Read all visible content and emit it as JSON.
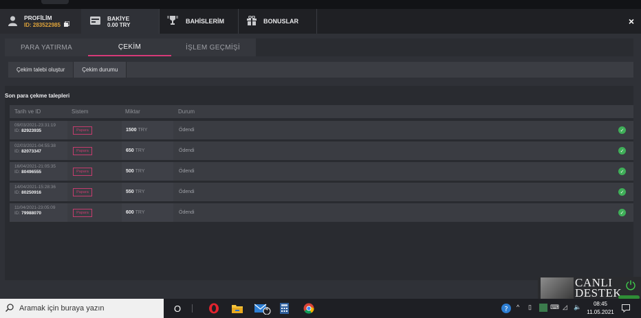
{
  "header": {
    "profile_title": "PROFİLİM",
    "profile_id": "ID: 283522985",
    "balance_title": "BAKİYE",
    "balance_value": "0.00 TRY",
    "bets_label": "BAHİSLERİM",
    "bonus_label": "BONUSLAR",
    "close": "×"
  },
  "tabs": [
    "PARA YATIRMA",
    "ÇEKİM",
    "İŞLEM GEÇMİŞİ"
  ],
  "actions": [
    "Çekim talebi oluştur",
    "Çekim durumu"
  ],
  "panel_title": "Son para çekme talepleri",
  "columns": [
    "Tarih ve ID",
    "Sistem",
    "Miktar",
    "Durum"
  ],
  "rows": [
    {
      "date": "09/03/2021-23:31:19",
      "id_prefix": "ID:",
      "id": "82923935",
      "system": "Papara",
      "amount": "1500",
      "currency": "TRY",
      "status": "Ödendi"
    },
    {
      "date": "02/03/2021-04:55:38",
      "id_prefix": "ID:",
      "id": "82073347",
      "system": "Papara",
      "amount": "650",
      "currency": "TRY",
      "status": "Ödendi"
    },
    {
      "date": "16/04/2021-21:05:35",
      "id_prefix": "ID:",
      "id": "80496555",
      "system": "Papara",
      "amount": "500",
      "currency": "TRY",
      "status": "Ödendi"
    },
    {
      "date": "14/04/2021-15:28:36",
      "id_prefix": "ID:",
      "id": "80250916",
      "system": "Papara",
      "amount": "550",
      "currency": "TRY",
      "status": "Ödendi"
    },
    {
      "date": "11/04/2021-23:05:09",
      "id_prefix": "ID:",
      "id": "79988070",
      "system": "Papara",
      "amount": "600",
      "currency": "TRY",
      "status": "Ödendi"
    }
  ],
  "support": {
    "line1": "CANLI",
    "line2": "DESTEK"
  },
  "taskbar": {
    "search_placeholder": "Aramak için buraya yazın",
    "mail_badge": "4",
    "time": "08:45",
    "date": "11.05.2021"
  },
  "colors": {
    "accent": "#d83a78",
    "success": "#3fae58",
    "id_highlight": "#e0a43a"
  }
}
